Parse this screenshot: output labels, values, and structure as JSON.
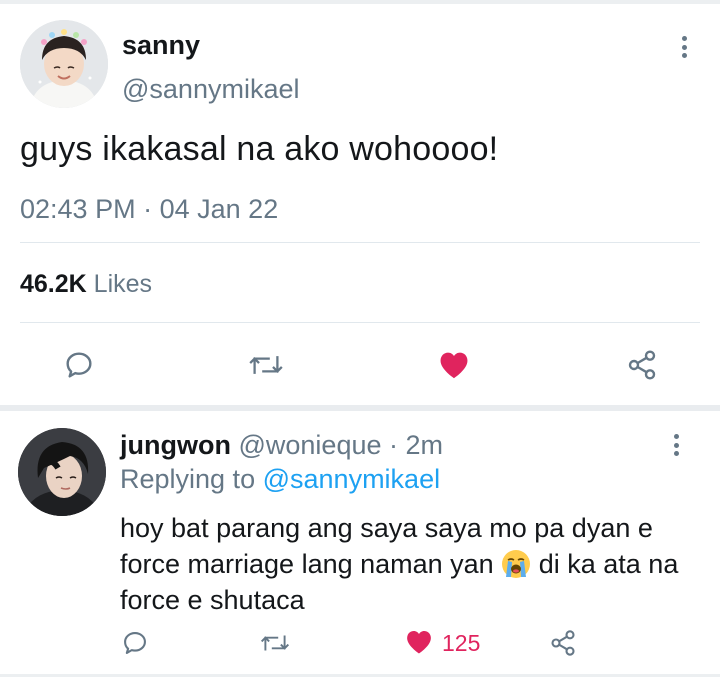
{
  "main_tweet": {
    "display_name": "sanny",
    "handle": "@sannymikael",
    "text": "guys ikakasal na ako wohoooo!",
    "time": "02:43 PM",
    "separator": "·",
    "date": "04 Jan 22",
    "likes_count": "46.2K",
    "likes_label": "Likes",
    "liked": true
  },
  "reply": {
    "display_name": "jungwon",
    "handle": "@wonieque",
    "separator": "·",
    "age": "2m",
    "replying_prefix": "Replying to",
    "replying_to": "@sannymikael",
    "text_part1": "hoy bat parang ang saya saya mo pa dyan e force marriage lang naman yan",
    "emoji": "loudly-crying-face",
    "text_part2": " di ka ata na force e shutaca",
    "like_count": "125",
    "liked": true
  },
  "colors": {
    "accent_blue": "#1da1f2",
    "like_red": "#e0245e",
    "secondary_text": "#657786",
    "primary_text": "#14171a"
  },
  "icons": [
    "reply-icon",
    "retweet-icon",
    "heart-icon",
    "share-icon",
    "more-options-icon"
  ]
}
